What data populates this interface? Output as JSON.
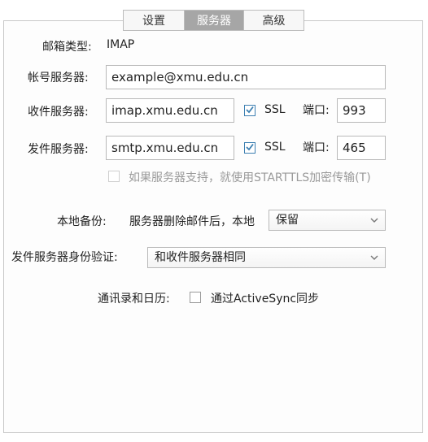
{
  "tabs": [
    {
      "label": "设置",
      "active": false
    },
    {
      "label": "服务器",
      "active": true
    },
    {
      "label": "高级",
      "active": false
    }
  ],
  "account_type": {
    "label": "邮箱类型:",
    "value": "IMAP"
  },
  "account_server": {
    "label": "帐号服务器:",
    "value": "example@xmu.edu.cn"
  },
  "incoming": {
    "label": "收件服务器:",
    "host": "imap.xmu.edu.cn",
    "ssl_label": "SSL",
    "ssl_checked": true,
    "port_label": "端口:",
    "port": "993"
  },
  "outgoing": {
    "label": "发件服务器:",
    "host": "smtp.xmu.edu.cn",
    "ssl_label": "SSL",
    "ssl_checked": true,
    "port_label": "端口:",
    "port": "465"
  },
  "starttls": {
    "label": "如果服务器支持，就使用STARTTLS加密传输(T)",
    "checked": false,
    "enabled": false
  },
  "local_backup": {
    "label": "本地备份:",
    "desc": "服务器删除邮件后，本地",
    "selected": "保留"
  },
  "smtp_auth": {
    "label": "发件服务器身份验证:",
    "selected": "和收件服务器相同"
  },
  "contacts_calendar": {
    "label": "通讯录和日历:",
    "checkbox_label": "通过ActiveSync同步",
    "checked": false
  },
  "colors": {
    "tab_active_bg": "#a6a6a6",
    "checkbox_accent": "#3c7fb1",
    "border": "#b9b9b9"
  },
  "icons": {
    "check": "checkmark-icon",
    "dropdown": "chevron-down-icon"
  }
}
